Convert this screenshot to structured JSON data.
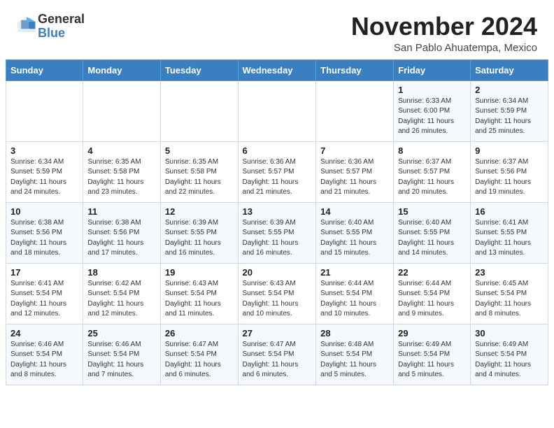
{
  "header": {
    "logo_general": "General",
    "logo_blue": "Blue",
    "month": "November 2024",
    "location": "San Pablo Ahuatempa, Mexico"
  },
  "days_of_week": [
    "Sunday",
    "Monday",
    "Tuesday",
    "Wednesday",
    "Thursday",
    "Friday",
    "Saturday"
  ],
  "weeks": [
    [
      {
        "day": "",
        "info": ""
      },
      {
        "day": "",
        "info": ""
      },
      {
        "day": "",
        "info": ""
      },
      {
        "day": "",
        "info": ""
      },
      {
        "day": "",
        "info": ""
      },
      {
        "day": "1",
        "info": "Sunrise: 6:33 AM\nSunset: 6:00 PM\nDaylight: 11 hours and 26 minutes."
      },
      {
        "day": "2",
        "info": "Sunrise: 6:34 AM\nSunset: 5:59 PM\nDaylight: 11 hours and 25 minutes."
      }
    ],
    [
      {
        "day": "3",
        "info": "Sunrise: 6:34 AM\nSunset: 5:59 PM\nDaylight: 11 hours and 24 minutes."
      },
      {
        "day": "4",
        "info": "Sunrise: 6:35 AM\nSunset: 5:58 PM\nDaylight: 11 hours and 23 minutes."
      },
      {
        "day": "5",
        "info": "Sunrise: 6:35 AM\nSunset: 5:58 PM\nDaylight: 11 hours and 22 minutes."
      },
      {
        "day": "6",
        "info": "Sunrise: 6:36 AM\nSunset: 5:57 PM\nDaylight: 11 hours and 21 minutes."
      },
      {
        "day": "7",
        "info": "Sunrise: 6:36 AM\nSunset: 5:57 PM\nDaylight: 11 hours and 21 minutes."
      },
      {
        "day": "8",
        "info": "Sunrise: 6:37 AM\nSunset: 5:57 PM\nDaylight: 11 hours and 20 minutes."
      },
      {
        "day": "9",
        "info": "Sunrise: 6:37 AM\nSunset: 5:56 PM\nDaylight: 11 hours and 19 minutes."
      }
    ],
    [
      {
        "day": "10",
        "info": "Sunrise: 6:38 AM\nSunset: 5:56 PM\nDaylight: 11 hours and 18 minutes."
      },
      {
        "day": "11",
        "info": "Sunrise: 6:38 AM\nSunset: 5:56 PM\nDaylight: 11 hours and 17 minutes."
      },
      {
        "day": "12",
        "info": "Sunrise: 6:39 AM\nSunset: 5:55 PM\nDaylight: 11 hours and 16 minutes."
      },
      {
        "day": "13",
        "info": "Sunrise: 6:39 AM\nSunset: 5:55 PM\nDaylight: 11 hours and 16 minutes."
      },
      {
        "day": "14",
        "info": "Sunrise: 6:40 AM\nSunset: 5:55 PM\nDaylight: 11 hours and 15 minutes."
      },
      {
        "day": "15",
        "info": "Sunrise: 6:40 AM\nSunset: 5:55 PM\nDaylight: 11 hours and 14 minutes."
      },
      {
        "day": "16",
        "info": "Sunrise: 6:41 AM\nSunset: 5:55 PM\nDaylight: 11 hours and 13 minutes."
      }
    ],
    [
      {
        "day": "17",
        "info": "Sunrise: 6:41 AM\nSunset: 5:54 PM\nDaylight: 11 hours and 12 minutes."
      },
      {
        "day": "18",
        "info": "Sunrise: 6:42 AM\nSunset: 5:54 PM\nDaylight: 11 hours and 12 minutes."
      },
      {
        "day": "19",
        "info": "Sunrise: 6:43 AM\nSunset: 5:54 PM\nDaylight: 11 hours and 11 minutes."
      },
      {
        "day": "20",
        "info": "Sunrise: 6:43 AM\nSunset: 5:54 PM\nDaylight: 11 hours and 10 minutes."
      },
      {
        "day": "21",
        "info": "Sunrise: 6:44 AM\nSunset: 5:54 PM\nDaylight: 11 hours and 10 minutes."
      },
      {
        "day": "22",
        "info": "Sunrise: 6:44 AM\nSunset: 5:54 PM\nDaylight: 11 hours and 9 minutes."
      },
      {
        "day": "23",
        "info": "Sunrise: 6:45 AM\nSunset: 5:54 PM\nDaylight: 11 hours and 8 minutes."
      }
    ],
    [
      {
        "day": "24",
        "info": "Sunrise: 6:46 AM\nSunset: 5:54 PM\nDaylight: 11 hours and 8 minutes."
      },
      {
        "day": "25",
        "info": "Sunrise: 6:46 AM\nSunset: 5:54 PM\nDaylight: 11 hours and 7 minutes."
      },
      {
        "day": "26",
        "info": "Sunrise: 6:47 AM\nSunset: 5:54 PM\nDaylight: 11 hours and 6 minutes."
      },
      {
        "day": "27",
        "info": "Sunrise: 6:47 AM\nSunset: 5:54 PM\nDaylight: 11 hours and 6 minutes."
      },
      {
        "day": "28",
        "info": "Sunrise: 6:48 AM\nSunset: 5:54 PM\nDaylight: 11 hours and 5 minutes."
      },
      {
        "day": "29",
        "info": "Sunrise: 6:49 AM\nSunset: 5:54 PM\nDaylight: 11 hours and 5 minutes."
      },
      {
        "day": "30",
        "info": "Sunrise: 6:49 AM\nSunset: 5:54 PM\nDaylight: 11 hours and 4 minutes."
      }
    ]
  ]
}
